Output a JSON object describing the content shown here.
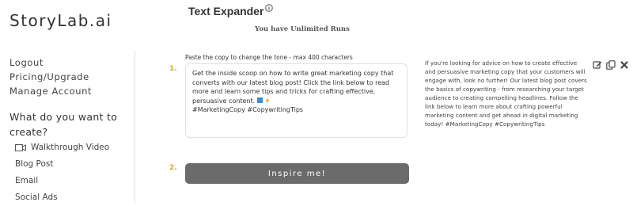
{
  "brand": {
    "logo": "StoryLab.ai"
  },
  "sidebar": {
    "links": [
      "Logout",
      "Pricing/Upgrade",
      "Manage Account"
    ],
    "heading": "What do you want to create?",
    "items": [
      "Walkthrough Video",
      "Blog Post",
      "Email",
      "Social Ads"
    ]
  },
  "tool": {
    "title": "Text Expander",
    "runs": "You have Unlimited Runs",
    "input_label": "Paste the copy to change the tone - max 400 characters",
    "step1": "1.",
    "step2": "2.",
    "input_value": "Get the inside scoop on how to write great marketing copy that converts with our latest blog post! Click the link below to read more and learn some tips and tricks for crafting effective, persuasive content.",
    "hashtags": "#MarketingCopy #CopywritingTips",
    "button_label": "Inspire me!"
  },
  "result": {
    "text": "If you're looking for advice on how to create effective and persuasive marketing copy that your customers will engage with, look no further! Our latest blog post covers the basics of copywriting - from researching your target audience to creating compelling headlines. Follow the link below to learn more about crafting powerful marketing content and get ahead in digital marketing today! #MarketingCopy #CopywritingTips"
  },
  "icons": {
    "info": "info-icon",
    "video": "video-icon",
    "edit": "edit-icon",
    "copy": "copy-icon",
    "close": "close-icon"
  },
  "colors": {
    "accent_step": "#e0a030",
    "button_bg": "#6b6b6b"
  }
}
